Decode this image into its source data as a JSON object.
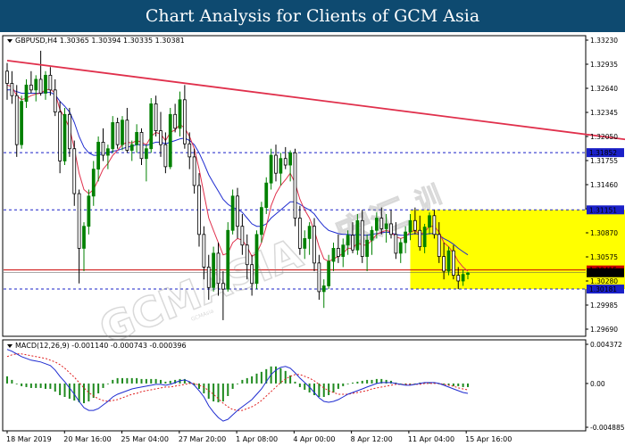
{
  "header": {
    "title": "Chart Analysis for Clients of GCM Asia"
  },
  "colors": {
    "header_bg": "#0e4a70",
    "up_candle": "#008000",
    "down_candle": "#000000",
    "trendline": "#e0304c",
    "ma_fast": "#e0304c",
    "ma_slow": "#1e2bd0",
    "zone": "#ffff00",
    "level_line": "#1a20c8",
    "price_line": "#cc0000",
    "macd_hist": "#1f8a1f",
    "macd_signal": "#e02020",
    "macd_main": "#1e2bd0"
  },
  "chart_data": [
    {
      "type": "candlestick",
      "symbol_info": "GBPUSD,H4  1.30365 1.30394 1.30335 1.30381",
      "y_ticks": [
        "1.33230",
        "1.32935",
        "1.32640",
        "1.32345",
        "1.32050",
        "1.31755",
        "1.31460",
        "1.31165",
        "1.30870",
        "1.30575",
        "1.30280",
        "1.29985",
        "1.29690"
      ],
      "ylim": [
        1.2969,
        1.3323
      ],
      "x_ticks": [
        "18 Mar 2019",
        "20 Mar 16:00",
        "25 Mar 04:00",
        "27 Mar 20:00",
        "1 Apr 08:00",
        "4 Apr 00:00",
        "8 Apr 12:00",
        "11 Apr 04:00",
        "15 Apr 16:00"
      ],
      "levels": [
        {
          "label": "1.31852",
          "value": 1.31852
        },
        {
          "label": "1.31151",
          "value": 1.31151
        },
        {
          "label": "1.30181",
          "value": 1.30181
        }
      ],
      "current_price": {
        "label": "1.30381",
        "value": 1.30381
      },
      "red_line_label": "1.30415",
      "red_line_value": 1.30415,
      "zone": {
        "from": 1.30181,
        "to": 1.31151,
        "x_start": 84,
        "x_end": 133
      },
      "trendline": {
        "start": [
          0,
          1.3298
        ],
        "end": [
          136,
          1.3196
        ]
      },
      "candles_ohlc": [
        [
          1.3285,
          1.3295,
          1.325,
          1.327
        ],
        [
          1.327,
          1.3285,
          1.3245,
          1.3255
        ],
        [
          1.3255,
          1.3268,
          1.318,
          1.3195
        ],
        [
          1.3195,
          1.3255,
          1.319,
          1.3248
        ],
        [
          1.3248,
          1.3275,
          1.324,
          1.3268
        ],
        [
          1.3268,
          1.3285,
          1.3258,
          1.3262
        ],
        [
          1.3262,
          1.328,
          1.3248,
          1.3275
        ],
        [
          1.3275,
          1.331,
          1.3255,
          1.3258
        ],
        [
          1.3258,
          1.3285,
          1.325,
          1.328
        ],
        [
          1.328,
          1.329,
          1.3255,
          1.3262
        ],
        [
          1.3262,
          1.3275,
          1.323,
          1.3235
        ],
        [
          1.3235,
          1.3248,
          1.316,
          1.3175
        ],
        [
          1.3175,
          1.324,
          1.317,
          1.3232
        ],
        [
          1.3232,
          1.324,
          1.318,
          1.319
        ],
        [
          1.319,
          1.32,
          1.312,
          1.3135
        ],
        [
          1.3135,
          1.314,
          1.3025,
          1.3068
        ],
        [
          1.3068,
          1.31,
          1.304,
          1.3095
        ],
        [
          1.3095,
          1.314,
          1.3085,
          1.3132
        ],
        [
          1.3132,
          1.3175,
          1.312,
          1.3165
        ],
        [
          1.3165,
          1.3205,
          1.315,
          1.3198
        ],
        [
          1.3198,
          1.3215,
          1.3175,
          1.3182
        ],
        [
          1.3182,
          1.3195,
          1.3165,
          1.319
        ],
        [
          1.319,
          1.323,
          1.3185,
          1.3222
        ],
        [
          1.3222,
          1.3228,
          1.319,
          1.3195
        ],
        [
          1.3195,
          1.323,
          1.3188,
          1.3225
        ],
        [
          1.3225,
          1.324,
          1.3185,
          1.3188
        ],
        [
          1.3188,
          1.32,
          1.3175,
          1.3195
        ],
        [
          1.3195,
          1.322,
          1.3185,
          1.321
        ],
        [
          1.321,
          1.3215,
          1.317,
          1.3178
        ],
        [
          1.3178,
          1.3195,
          1.315,
          1.319
        ],
        [
          1.319,
          1.3252,
          1.3185,
          1.3245
        ],
        [
          1.3245,
          1.3255,
          1.3205,
          1.3212
        ],
        [
          1.3212,
          1.3235,
          1.318,
          1.3195
        ],
        [
          1.3195,
          1.321,
          1.316,
          1.3168
        ],
        [
          1.3168,
          1.324,
          1.3165,
          1.3232
        ],
        [
          1.3232,
          1.3245,
          1.321,
          1.3215
        ],
        [
          1.3215,
          1.326,
          1.3205,
          1.325
        ],
        [
          1.325,
          1.3268,
          1.319,
          1.3196
        ],
        [
          1.3196,
          1.321,
          1.3165,
          1.318
        ],
        [
          1.318,
          1.319,
          1.3135,
          1.3145
        ],
        [
          1.3145,
          1.316,
          1.307,
          1.3085
        ],
        [
          1.3085,
          1.3095,
          1.303,
          1.3045
        ],
        [
          1.3045,
          1.306,
          1.3005,
          1.302
        ],
        [
          1.302,
          1.307,
          1.3015,
          1.3062
        ],
        [
          1.3062,
          1.3075,
          1.301,
          1.3025
        ],
        [
          1.3025,
          1.304,
          1.298,
          1.3018
        ],
        [
          1.3018,
          1.31,
          1.3015,
          1.309
        ],
        [
          1.309,
          1.314,
          1.3085,
          1.3132
        ],
        [
          1.3132,
          1.3142,
          1.308,
          1.3095
        ],
        [
          1.3095,
          1.311,
          1.306,
          1.3072
        ],
        [
          1.3072,
          1.3085,
          1.303,
          1.3048
        ],
        [
          1.3048,
          1.306,
          1.301,
          1.3025
        ],
        [
          1.3025,
          1.309,
          1.3018,
          1.3085
        ],
        [
          1.3085,
          1.3125,
          1.3075,
          1.3118
        ],
        [
          1.3118,
          1.3155,
          1.311,
          1.3148
        ],
        [
          1.3148,
          1.319,
          1.314,
          1.3182
        ],
        [
          1.3182,
          1.3195,
          1.315,
          1.316
        ],
        [
          1.316,
          1.3185,
          1.3145,
          1.3178
        ],
        [
          1.3178,
          1.3192,
          1.3165,
          1.317
        ],
        [
          1.317,
          1.3188,
          1.315,
          1.3185
        ],
        [
          1.3185,
          1.319,
          1.3095,
          1.3105
        ],
        [
          1.3105,
          1.312,
          1.306,
          1.3068
        ],
        [
          1.3068,
          1.309,
          1.3055,
          1.308
        ],
        [
          1.308,
          1.31,
          1.306,
          1.3095
        ],
        [
          1.3095,
          1.3105,
          1.304,
          1.305
        ],
        [
          1.305,
          1.306,
          1.3005,
          1.3015
        ],
        [
          1.3015,
          1.303,
          1.2995,
          1.3022
        ],
        [
          1.3022,
          1.306,
          1.3018,
          1.3052
        ],
        [
          1.3052,
          1.3075,
          1.304,
          1.3068
        ],
        [
          1.3068,
          1.3085,
          1.305,
          1.3058
        ],
        [
          1.3058,
          1.308,
          1.3045,
          1.3072
        ],
        [
          1.3072,
          1.309,
          1.306,
          1.3084
        ],
        [
          1.3084,
          1.31,
          1.3062,
          1.3066
        ],
        [
          1.3066,
          1.311,
          1.306,
          1.3102
        ],
        [
          1.3102,
          1.3115,
          1.305,
          1.3058
        ],
        [
          1.3058,
          1.3085,
          1.304,
          1.3078
        ],
        [
          1.3078,
          1.3095,
          1.306,
          1.309
        ],
        [
          1.309,
          1.3112,
          1.308,
          1.3105
        ],
        [
          1.3105,
          1.3118,
          1.3085,
          1.3092
        ],
        [
          1.3092,
          1.311,
          1.3075,
          1.3098
        ],
        [
          1.3098,
          1.3115,
          1.308,
          1.3085
        ],
        [
          1.3085,
          1.31,
          1.3055,
          1.3062
        ],
        [
          1.3062,
          1.308,
          1.305,
          1.3075
        ],
        [
          1.3075,
          1.3095,
          1.3062,
          1.3088
        ],
        [
          1.3088,
          1.311,
          1.3078,
          1.3102
        ],
        [
          1.3102,
          1.3118,
          1.3085,
          1.309
        ],
        [
          1.309,
          1.3108,
          1.3065,
          1.307
        ],
        [
          1.307,
          1.3098,
          1.3062,
          1.3094
        ],
        [
          1.3094,
          1.3112,
          1.3085,
          1.3108
        ],
        [
          1.3108,
          1.3115,
          1.308,
          1.3085
        ],
        [
          1.3085,
          1.31,
          1.305,
          1.3058
        ],
        [
          1.3058,
          1.3075,
          1.303,
          1.304
        ],
        [
          1.304,
          1.307,
          1.3035,
          1.3065
        ],
        [
          1.3065,
          1.3072,
          1.303,
          1.3035
        ],
        [
          1.3035,
          1.3045,
          1.3018,
          1.3028
        ],
        [
          1.3028,
          1.3042,
          1.3022,
          1.3036
        ],
        [
          1.3036,
          1.3039,
          1.303,
          1.3038
        ]
      ],
      "ma_fast_values": [
        1.3268,
        1.3266,
        1.3255,
        1.325,
        1.3252,
        1.3255,
        1.3257,
        1.3258,
        1.3262,
        1.3263,
        1.3258,
        1.3238,
        1.3228,
        1.3215,
        1.319,
        1.316,
        1.314,
        1.3135,
        1.314,
        1.3152,
        1.3165,
        1.3172,
        1.3182,
        1.3188,
        1.3195,
        1.3198,
        1.3197,
        1.32,
        1.3198,
        1.3195,
        1.3205,
        1.321,
        1.3208,
        1.32,
        1.321,
        1.3213,
        1.322,
        1.3215,
        1.3205,
        1.319,
        1.3165,
        1.3135,
        1.3105,
        1.309,
        1.3075,
        1.306,
        1.3062,
        1.3075,
        1.308,
        1.3078,
        1.307,
        1.3058,
        1.3062,
        1.3075,
        1.3095,
        1.312,
        1.3135,
        1.3145,
        1.3152,
        1.316,
        1.3148,
        1.3128,
        1.3115,
        1.3105,
        1.309,
        1.307,
        1.3055,
        1.3052,
        1.3055,
        1.3058,
        1.3062,
        1.3068,
        1.3068,
        1.3075,
        1.3072,
        1.3072,
        1.3078,
        1.3085,
        1.3088,
        1.309,
        1.3088,
        1.3082,
        1.308,
        1.3082,
        1.3088,
        1.309,
        1.3085,
        1.3088,
        1.3095,
        1.3095,
        1.3088,
        1.3075,
        1.307,
        1.3062,
        1.3052,
        1.3045,
        1.304
      ],
      "ma_slow_values": [
        1.3262,
        1.3262,
        1.326,
        1.3258,
        1.3258,
        1.3258,
        1.3258,
        1.3258,
        1.3259,
        1.3259,
        1.3256,
        1.3248,
        1.3242,
        1.3235,
        1.3222,
        1.3205,
        1.3192,
        1.3185,
        1.3182,
        1.3182,
        1.3184,
        1.3185,
        1.3187,
        1.3188,
        1.319,
        1.3192,
        1.3193,
        1.3195,
        1.3195,
        1.3194,
        1.3196,
        1.3198,
        1.3198,
        1.3196,
        1.3198,
        1.32,
        1.3202,
        1.3203,
        1.32,
        1.3195,
        1.3185,
        1.3172,
        1.3158,
        1.3148,
        1.3138,
        1.3128,
        1.3122,
        1.3118,
        1.3116,
        1.3112,
        1.3105,
        1.3098,
        1.3095,
        1.3095,
        1.3098,
        1.3105,
        1.311,
        1.3115,
        1.312,
        1.3125,
        1.3125,
        1.3122,
        1.3118,
        1.3115,
        1.311,
        1.3102,
        1.3095,
        1.309,
        1.3088,
        1.3086,
        1.3085,
        1.3085,
        1.3084,
        1.3085,
        1.3084,
        1.3084,
        1.3085,
        1.3086,
        1.3087,
        1.3088,
        1.3087,
        1.3085,
        1.3084,
        1.3084,
        1.3085,
        1.3086,
        1.3085,
        1.3085,
        1.3086,
        1.3086,
        1.3084,
        1.308,
        1.3077,
        1.3073,
        1.3068,
        1.3064,
        1.306
      ]
    },
    {
      "type": "macd",
      "label": "MACD(12,26,9) -0.001140 -0.000743 -0.000396",
      "y_ticks": [
        "0.004372",
        "0.00",
        "-0.004885"
      ],
      "ylim": [
        -0.004885,
        0.004372
      ],
      "main_values": [
        0.0038,
        0.0036,
        0.0033,
        0.003,
        0.0028,
        0.0026,
        0.0025,
        0.0024,
        0.0022,
        0.002,
        0.0015,
        0.0008,
        0.0002,
        -0.0005,
        -0.0012,
        -0.002,
        -0.0027,
        -0.003,
        -0.003,
        -0.0028,
        -0.0024,
        -0.002,
        -0.0015,
        -0.0012,
        -0.001,
        -0.0008,
        -0.0006,
        -0.0005,
        -0.0004,
        -0.0003,
        -0.0002,
        -0.0001,
        -0.0001,
        -0.0002,
        -0.0001,
        0.0001,
        0.0003,
        0.0004,
        0.0002,
        -0.0002,
        -0.0008,
        -0.0015,
        -0.0025,
        -0.0032,
        -0.0038,
        -0.0042,
        -0.004,
        -0.0035,
        -0.003,
        -0.0026,
        -0.0022,
        -0.0018,
        -0.0012,
        -0.0006,
        0.0002,
        0.001,
        0.0015,
        0.0018,
        0.0019,
        0.0017,
        0.0012,
        0.0006,
        0.0001,
        -0.0004,
        -0.001,
        -0.0016,
        -0.002,
        -0.0021,
        -0.002,
        -0.0018,
        -0.0015,
        -0.0012,
        -0.001,
        -0.0008,
        -0.0006,
        -0.0004,
        -0.0002,
        0.0,
        0.0001,
        0.0001,
        0.0001,
        0.0,
        -0.0001,
        -0.0002,
        -0.0002,
        -0.0001,
        0.0,
        0.0001,
        0.0001,
        0.0001,
        0.0,
        -0.0002,
        -0.0004,
        -0.0006,
        -0.0008,
        -0.001,
        -0.0011
      ],
      "signal_values": [
        0.003,
        0.0032,
        0.0033,
        0.0033,
        0.0032,
        0.0031,
        0.003,
        0.0029,
        0.0028,
        0.0026,
        0.0024,
        0.0021,
        0.0017,
        0.0012,
        0.0007,
        0.0001,
        -0.0005,
        -0.001,
        -0.0014,
        -0.0017,
        -0.0019,
        -0.002,
        -0.0019,
        -0.0018,
        -0.0016,
        -0.0014,
        -0.0012,
        -0.0011,
        -0.0009,
        -0.0008,
        -0.0007,
        -0.0006,
        -0.0005,
        -0.0004,
        -0.0004,
        -0.0003,
        -0.0002,
        -0.0001,
        0.0,
        0.0,
        -0.0002,
        -0.0004,
        -0.0008,
        -0.0012,
        -0.0017,
        -0.0022,
        -0.0026,
        -0.0029,
        -0.003,
        -0.003,
        -0.0028,
        -0.0026,
        -0.0023,
        -0.0019,
        -0.0014,
        -0.0009,
        -0.0004,
        0.0001,
        0.0005,
        0.0008,
        0.001,
        0.001,
        0.0008,
        0.0006,
        0.0003,
        -0.0001,
        -0.0005,
        -0.0008,
        -0.001,
        -0.0012,
        -0.0012,
        -0.0012,
        -0.0011,
        -0.001,
        -0.0009,
        -0.0008,
        -0.0006,
        -0.0005,
        -0.0004,
        -0.0003,
        -0.0002,
        -0.0001,
        -0.0001,
        -0.0001,
        -0.0001,
        -0.0001,
        -0.0001,
        0.0,
        0.0,
        0.0,
        0.0,
        -0.0001,
        -0.0002,
        -0.0003,
        -0.0005,
        -0.0006,
        -0.0007
      ],
      "histogram_values": [
        0.0008,
        0.0004,
        0.0,
        -0.0003,
        -0.0004,
        -0.0005,
        -0.0005,
        -0.0005,
        -0.0006,
        -0.0006,
        -0.0009,
        -0.0013,
        -0.0015,
        -0.0017,
        -0.0019,
        -0.0021,
        -0.0022,
        -0.002,
        -0.0016,
        -0.0011,
        -0.0005,
        0.0,
        0.0004,
        0.0006,
        0.0006,
        0.0006,
        0.0006,
        0.0006,
        0.0005,
        0.0005,
        0.0005,
        0.0005,
        0.0004,
        0.0002,
        0.0003,
        0.0004,
        0.0005,
        0.0005,
        0.0002,
        -0.0002,
        -0.0006,
        -0.0011,
        -0.0017,
        -0.002,
        -0.0021,
        -0.002,
        -0.0014,
        -0.0006,
        0.0,
        0.0004,
        0.0006,
        0.0008,
        0.0011,
        0.0013,
        0.0016,
        0.0019,
        0.0019,
        0.0017,
        0.0014,
        0.0009,
        0.0002,
        -0.0004,
        -0.0007,
        -0.001,
        -0.0013,
        -0.0015,
        -0.0015,
        -0.0013,
        -0.001,
        -0.0006,
        -0.0003,
        0.0,
        0.0001,
        0.0002,
        0.0003,
        0.0004,
        0.0004,
        0.0005,
        0.0005,
        0.0004,
        0.0003,
        0.0001,
        0.0,
        -0.0001,
        -0.0001,
        0.0,
        0.0001,
        0.0001,
        0.0001,
        0.0001,
        0.0,
        -0.0001,
        -0.0002,
        -0.0003,
        -0.0003,
        -0.0004,
        -0.0004
      ]
    }
  ],
  "watermark": {
    "text_main": "GCMASIA",
    "text_cn": "宏汇",
    "text_sub": "GCMAsia"
  }
}
